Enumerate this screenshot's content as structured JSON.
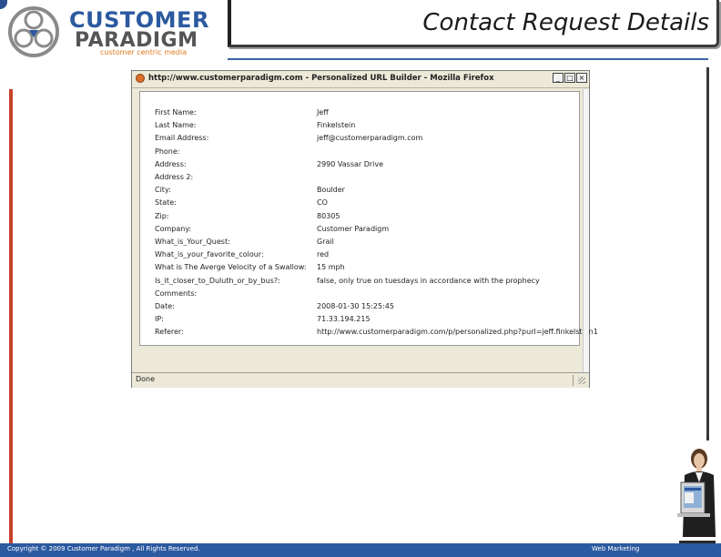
{
  "slide": {
    "title": "Contact Request Details",
    "logo_line1": "CUSTOMER",
    "logo_line2": "PARADIGM",
    "logo_tagline": "customer centric media",
    "footer_copyright": "Copyright © 2009 Customer Paradigm , All Rights Reserved.",
    "footer_right": "Web Marketing"
  },
  "browser": {
    "title": "http://www.customerparadigm.com - Personalized URL Builder - Mozilla Firefox",
    "status": "Done",
    "buttons": {
      "minimize": "_",
      "maximize": "□",
      "close": "×"
    }
  },
  "details": [
    {
      "label": "First Name:",
      "value": "Jeff"
    },
    {
      "label": "Last Name:",
      "value": "Finkelstein"
    },
    {
      "label": "Email Address:",
      "value": "jeff@customerparadigm.com"
    },
    {
      "label": "Phone:",
      "value": ""
    },
    {
      "label": "Address:",
      "value": "2990 Vassar Drive"
    },
    {
      "label": "Address 2:",
      "value": ""
    },
    {
      "label": "City:",
      "value": "Boulder"
    },
    {
      "label": "State:",
      "value": "CO"
    },
    {
      "label": "Zip:",
      "value": "80305"
    },
    {
      "label": "Company:",
      "value": "Customer Paradigm"
    },
    {
      "label": "What_is_Your_Quest:",
      "value": "Grail"
    },
    {
      "label": "What_is_your_favorite_colour:",
      "value": "red"
    },
    {
      "label": "What is The Averge Velocity of a Swallow:",
      "value": "15 mph"
    },
    {
      "label": "Is_it_closer_to_Duluth_or_by_bus?:",
      "value": "false, only true on tuesdays in accordance with the prophecy"
    },
    {
      "label": "Comments:",
      "value": ""
    },
    {
      "label": "Date:",
      "value": "2008-01-30 15:25:45"
    },
    {
      "label": "IP:",
      "value": "71.33.194.215"
    },
    {
      "label": "Referer:",
      "value": "http://www.customerparadigm.com/p/personalized.php?purl=jeff.finkelstein1"
    }
  ],
  "colors": {
    "brand_blue": "#2c5aa0",
    "accent_red": "#c8422b",
    "tagline_orange": "#e07a1e"
  }
}
